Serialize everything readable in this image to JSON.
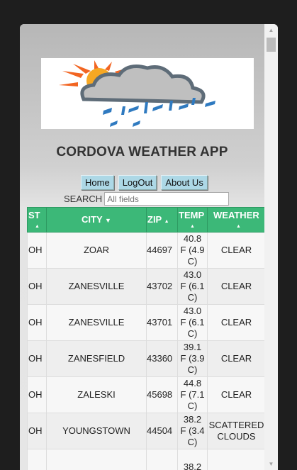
{
  "app": {
    "title": "CORDOVA WEATHER APP"
  },
  "nav": {
    "home": "Home",
    "logout": "LogOut",
    "about": "About Us"
  },
  "search": {
    "label": "SEARCH",
    "placeholder": "All fields"
  },
  "table": {
    "headers": {
      "state": "ST",
      "city": "CITY",
      "zip": "ZIP",
      "temp": "TEMP",
      "weather": "WEATHER"
    },
    "rows": [
      {
        "state": "OH",
        "city": "ZOAR",
        "zip": "44697",
        "temp": [
          "40.8",
          "F (4.9",
          "C)"
        ],
        "weather": [
          "CLEAR"
        ]
      },
      {
        "state": "OH",
        "city": "ZANESVILLE",
        "zip": "43702",
        "temp": [
          "43.0",
          "F (6.1",
          "C)"
        ],
        "weather": [
          "CLEAR"
        ]
      },
      {
        "state": "OH",
        "city": "ZANESVILLE",
        "zip": "43701",
        "temp": [
          "43.0",
          "F (6.1",
          "C)"
        ],
        "weather": [
          "CLEAR"
        ]
      },
      {
        "state": "OH",
        "city": "ZANESFIELD",
        "zip": "43360",
        "temp": [
          "39.1",
          "F (3.9",
          "C)"
        ],
        "weather": [
          "CLEAR"
        ]
      },
      {
        "state": "OH",
        "city": "ZALESKI",
        "zip": "45698",
        "temp": [
          "44.8",
          "F (7.1",
          "C)"
        ],
        "weather": [
          "CLEAR"
        ]
      },
      {
        "state": "OH",
        "city": "YOUNGSTOWN",
        "zip": "44504",
        "temp": [
          "38.2",
          "F (3.4",
          "C)"
        ],
        "weather": [
          "SCATTERED",
          "CLOUDS"
        ]
      },
      {
        "state": "",
        "city": "",
        "zip": "",
        "temp": [
          "38.2",
          "",
          ""
        ],
        "weather": [
          ""
        ]
      }
    ]
  },
  "colors": {
    "header_green": "#3cb878",
    "nav_button": "#add8e6"
  },
  "icons": {
    "logo": "weather-sun-cloud-rain-logo"
  }
}
